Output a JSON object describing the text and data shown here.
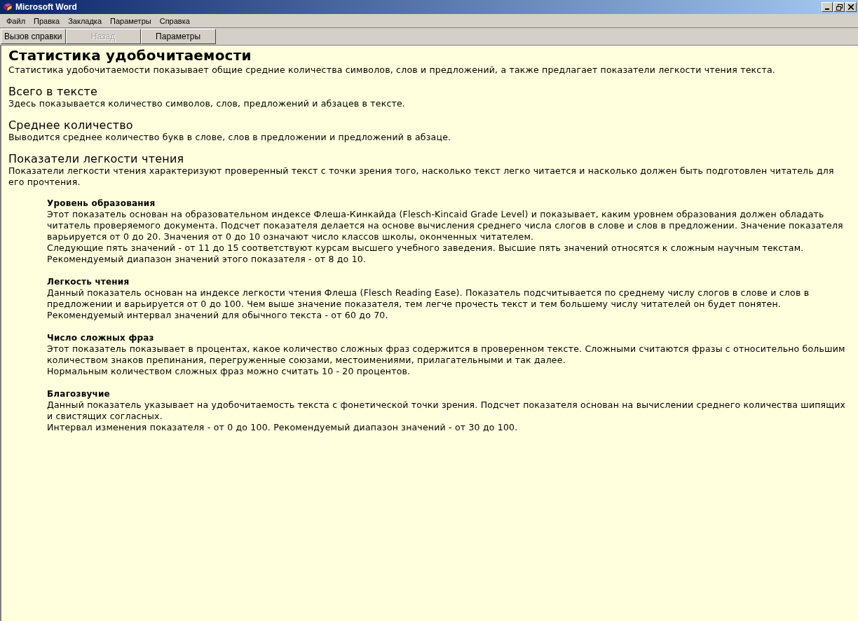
{
  "window": {
    "title": "Microsoft Word"
  },
  "menu": [
    {
      "label": "Файл"
    },
    {
      "label": "Правка"
    },
    {
      "label": "Закладка"
    },
    {
      "label": "Параметры"
    },
    {
      "label": "Справка"
    }
  ],
  "toolbar": [
    {
      "label": "Вызов справки",
      "disabled": false
    },
    {
      "label": "Назад",
      "disabled": true
    },
    {
      "label": "Параметры",
      "disabled": false
    }
  ],
  "document": {
    "title": "Статистика удобочитаемости",
    "intro": "Статистика удобочитаемости показывает общие средние количества символов, слов и предложений, а также предлагает показатели легкости чтения текста.",
    "sections": [
      {
        "heading": "Всего в тексте",
        "text": "Здесь показывается количество символов, слов, предложений и абзацев в тексте."
      },
      {
        "heading": "Среднее количество",
        "text": "Выводится среднее количество букв в слове, слов в предложении и предложений в абзаце."
      },
      {
        "heading": "Показатели легкости чтения",
        "text": "Показатели легкости чтения характеризуют проверенный текст с точки зрения того, насколько текст легко читается и насколько должен быть подготовлен читатель для его прочтения."
      }
    ],
    "subsections": [
      {
        "heading": "Уровень образования",
        "paragraphs": [
          "Этот показатель основан на образовательном индексе Флеша-Кинкайда (Flesch-Kincaid Grade Level) и показывает, каким уровнем образования должен обладать читатель проверяемого документа. Подсчет показателя делается на основе вычисления среднего числа слогов в слове и слов в предложении. Значение показателя варьируется от 0 до 20. Значения от 0 до 10 означают число классов школы, оконченных читателем.",
          "Следующие пять значений - от 11 до 15 соответствуют курсам высшего учебного заведения. Высшие пять значений относятся  к сложным научным текстам.",
          "Рекомендуемый диапазон значений этого показателя - от 8 до 10."
        ]
      },
      {
        "heading": "Легкость чтения",
        "paragraphs": [
          "Данный показатель основан на индексе легкости чтения Флеша (Flesch Reading Ease). Показатель подсчитывается по среднему числу слогов в слове и слов в предложении и варьируется от 0 до 100. Чем выше значение показателя, тем легче прочесть текст и тем большему числу читателей он будет понятен.",
          "Рекомендуемый интервал значений для обычного текста - от 60 до 70."
        ]
      },
      {
        "heading": "Число сложных фраз",
        "paragraphs": [
          "Этот показатель показывает в процентах, какое количество сложных фраз содержится в проверенном тексте. Сложными считаются фразы с относительно большим количеством знаков препинания, перегруженные союзами, местоимениями, прилагательными и так далее.",
          "Нормальным количеством сложных фраз можно считать 10 - 20 процентов."
        ]
      },
      {
        "heading": "Благозвучие",
        "paragraphs": [
          "Данный показатель указывает на удобочитаемость текста с фонетической точки зрения. Подсчет показателя основан на вычислении среднего количества шипящих и свистящих согласных.",
          "Интервал изменения показателя - от 0 до 100. Рекомендуемый диапазон значений - от 30 до 100."
        ]
      }
    ]
  }
}
